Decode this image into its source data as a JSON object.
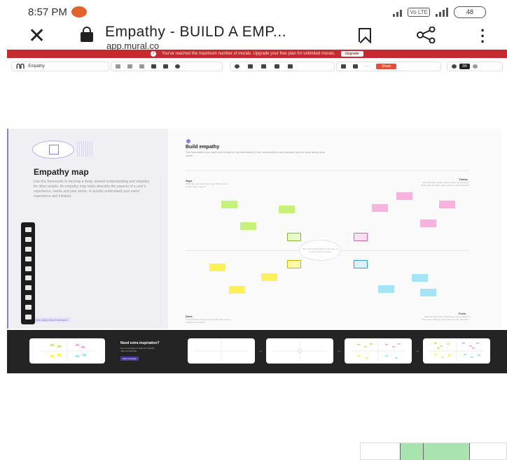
{
  "status_bar": {
    "time": "8:57 PM",
    "network": "Vo LTE",
    "battery": "48"
  },
  "browser": {
    "title": "Empathy - BUILD A EMP...",
    "url": "app.mural.co",
    "icons": [
      "close-icon",
      "lock-icon",
      "bookmark-icon",
      "share-icon",
      "more-icon"
    ]
  },
  "banner": {
    "message": "You've reached the maximum number of murals. Upgrade your free plan for unlimited murals.",
    "button": "Upgrade",
    "color": "#c62a2f"
  },
  "toolbar": {
    "mural_name": "Empathy",
    "share_label": "Share",
    "member_count": "3/6",
    "accent": "#e94b3c"
  },
  "left_panel": {
    "title": "Empathy map",
    "body": "Use this framework to develop a deep, shared understanding and empathy for other people. An empathy map helps describe the aspects of a user's experience, needs and pain points, to quickly understand your users' experience and mindset.",
    "link": "Learn more about this framework"
  },
  "board": {
    "title": "Build empathy",
    "subtitle": "The information you add here should be representative of the observations and research you've done about your users.",
    "center_text": "Write a short description of the user or persona you're creating",
    "quadrants": {
      "says": {
        "label": "Says",
        "desc": "What have we heard them say? What can we imagine them saying?"
      },
      "thinks": {
        "label": "Thinks",
        "desc": "What are their wants, needs, hopes, and dreams? What other thoughts might influence their behavior?"
      },
      "does": {
        "label": "Does",
        "desc": "What behavior have we observed? What can we imagine them doing?"
      },
      "feels": {
        "label": "Feels",
        "desc": "What are their fears, frustrations, and anxieties? What other feelings might influence their behavior?"
      }
    },
    "sticky_colors": {
      "green": "#c7f27a",
      "pink": "#f7b3dd",
      "yellow": "#fbf15a",
      "blue": "#a5e3f7"
    }
  },
  "strip": {
    "title": "Need extra inspiration?",
    "sub": "See an example of what an empathy map can look like",
    "button": "Open example"
  }
}
